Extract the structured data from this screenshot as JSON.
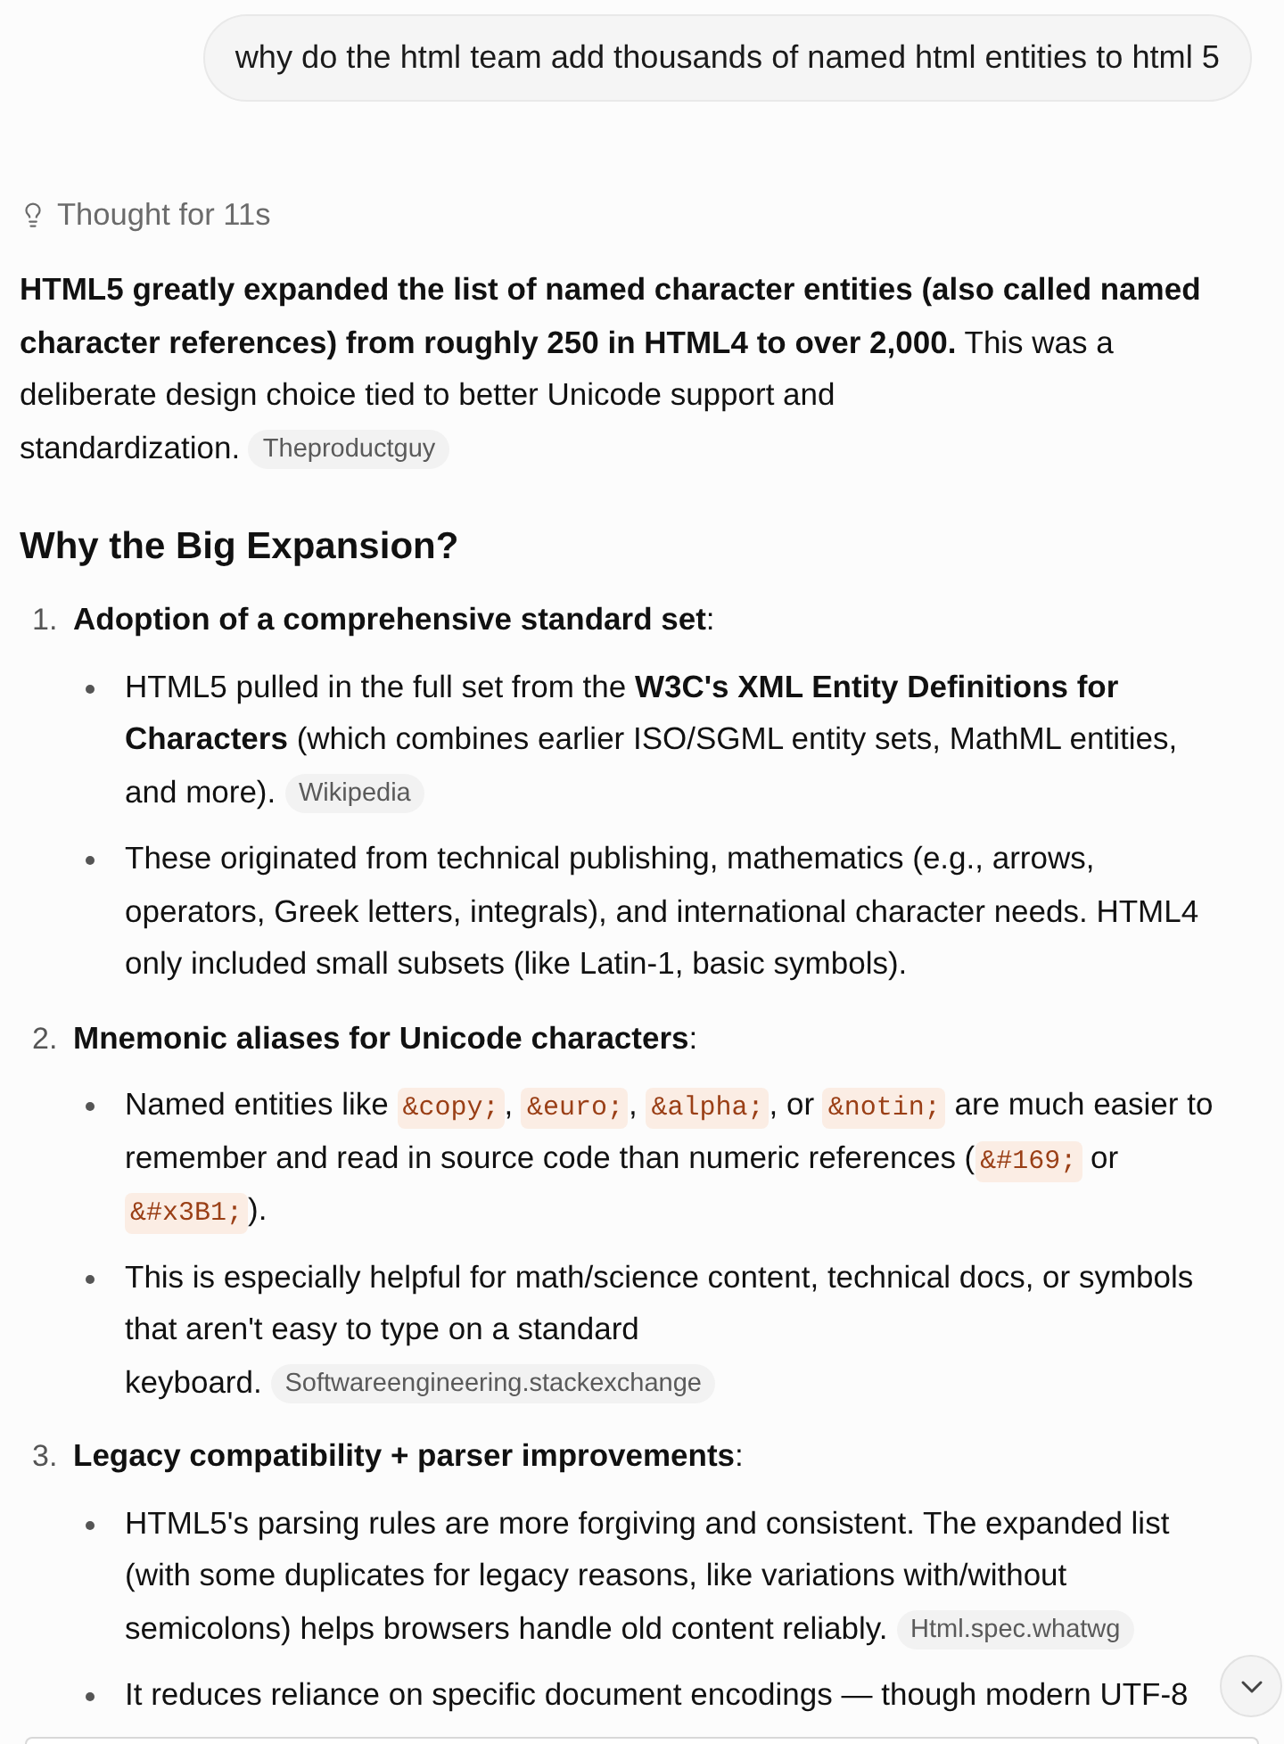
{
  "user_message": {
    "text": "why do the html team add thousands of named html entities to html 5"
  },
  "thought": {
    "label": "Thought for 11s"
  },
  "answer": {
    "intro": [
      {
        "kind": "text",
        "text": "**HTML5 greatly expanded the list of named character entities (also called named character references) from roughly 250 in HTML4 to over 2,000.** This was a deliberate design choice tied to better Unicode support and standardization. "
      },
      {
        "kind": "citation",
        "text": "Theproductguy"
      }
    ],
    "heading": "Why the Big Expansion?",
    "sections": [
      {
        "number": "1.",
        "title": "**Adoption of a comprehensive standard set**:",
        "bullets": [
          [
            {
              "kind": "text",
              "text": "HTML5 pulled in the full set from the **W3C's XML Entity Definitions for Characters** (which combines earlier ISO/SGML entity sets, MathML entities, and more). "
            },
            {
              "kind": "citation",
              "text": "Wikipedia"
            }
          ],
          [
            {
              "kind": "text",
              "text": "These originated from technical publishing, mathematics (e.g., arrows, operators, Greek letters, integrals), and international character needs. HTML4 only included small subsets (like Latin-1, basic symbols)."
            }
          ]
        ]
      },
      {
        "number": "2.",
        "title": "**Mnemonic aliases for Unicode characters**:",
        "bullets": [
          [
            {
              "kind": "text",
              "text": "Named entities like "
            },
            {
              "kind": "code",
              "text": "&copy;"
            },
            {
              "kind": "text",
              "text": ", "
            },
            {
              "kind": "code",
              "text": "&euro;"
            },
            {
              "kind": "text",
              "text": ", "
            },
            {
              "kind": "code",
              "text": "&alpha;"
            },
            {
              "kind": "text",
              "text": ", or "
            },
            {
              "kind": "code",
              "text": "&notin;"
            },
            {
              "kind": "text",
              "text": " are much easier to remember and read in source code than numeric references ("
            },
            {
              "kind": "code",
              "text": "&#169;"
            },
            {
              "kind": "text",
              "text": " or "
            },
            {
              "kind": "code",
              "text": "&#x3B1;"
            },
            {
              "kind": "text",
              "text": ")."
            }
          ],
          [
            {
              "kind": "text",
              "text": "This is especially helpful for math/science content, technical docs, or symbols that aren't easy to type on a standard keyboard. "
            },
            {
              "kind": "citation",
              "text": "Softwareengineering.stackexchange"
            }
          ]
        ]
      },
      {
        "number": "3.",
        "title": "**Legacy compatibility + parser improvements**:",
        "bullets": [
          [
            {
              "kind": "text",
              "text": "HTML5's parsing rules are more forgiving and consistent. The expanded list (with some duplicates for legacy reasons, like variations with/without semicolons) helps browsers handle old content reliably. "
            },
            {
              "kind": "citation",
              "text": "Html.spec.whatwg"
            }
          ],
          [
            {
              "kind": "text",
              "text": "It reduces reliance on specific document encodings — though modern UTF-8"
            }
          ]
        ]
      }
    ]
  },
  "composer": {
    "visible": true
  },
  "scroll_button": {
    "visible": true
  }
}
